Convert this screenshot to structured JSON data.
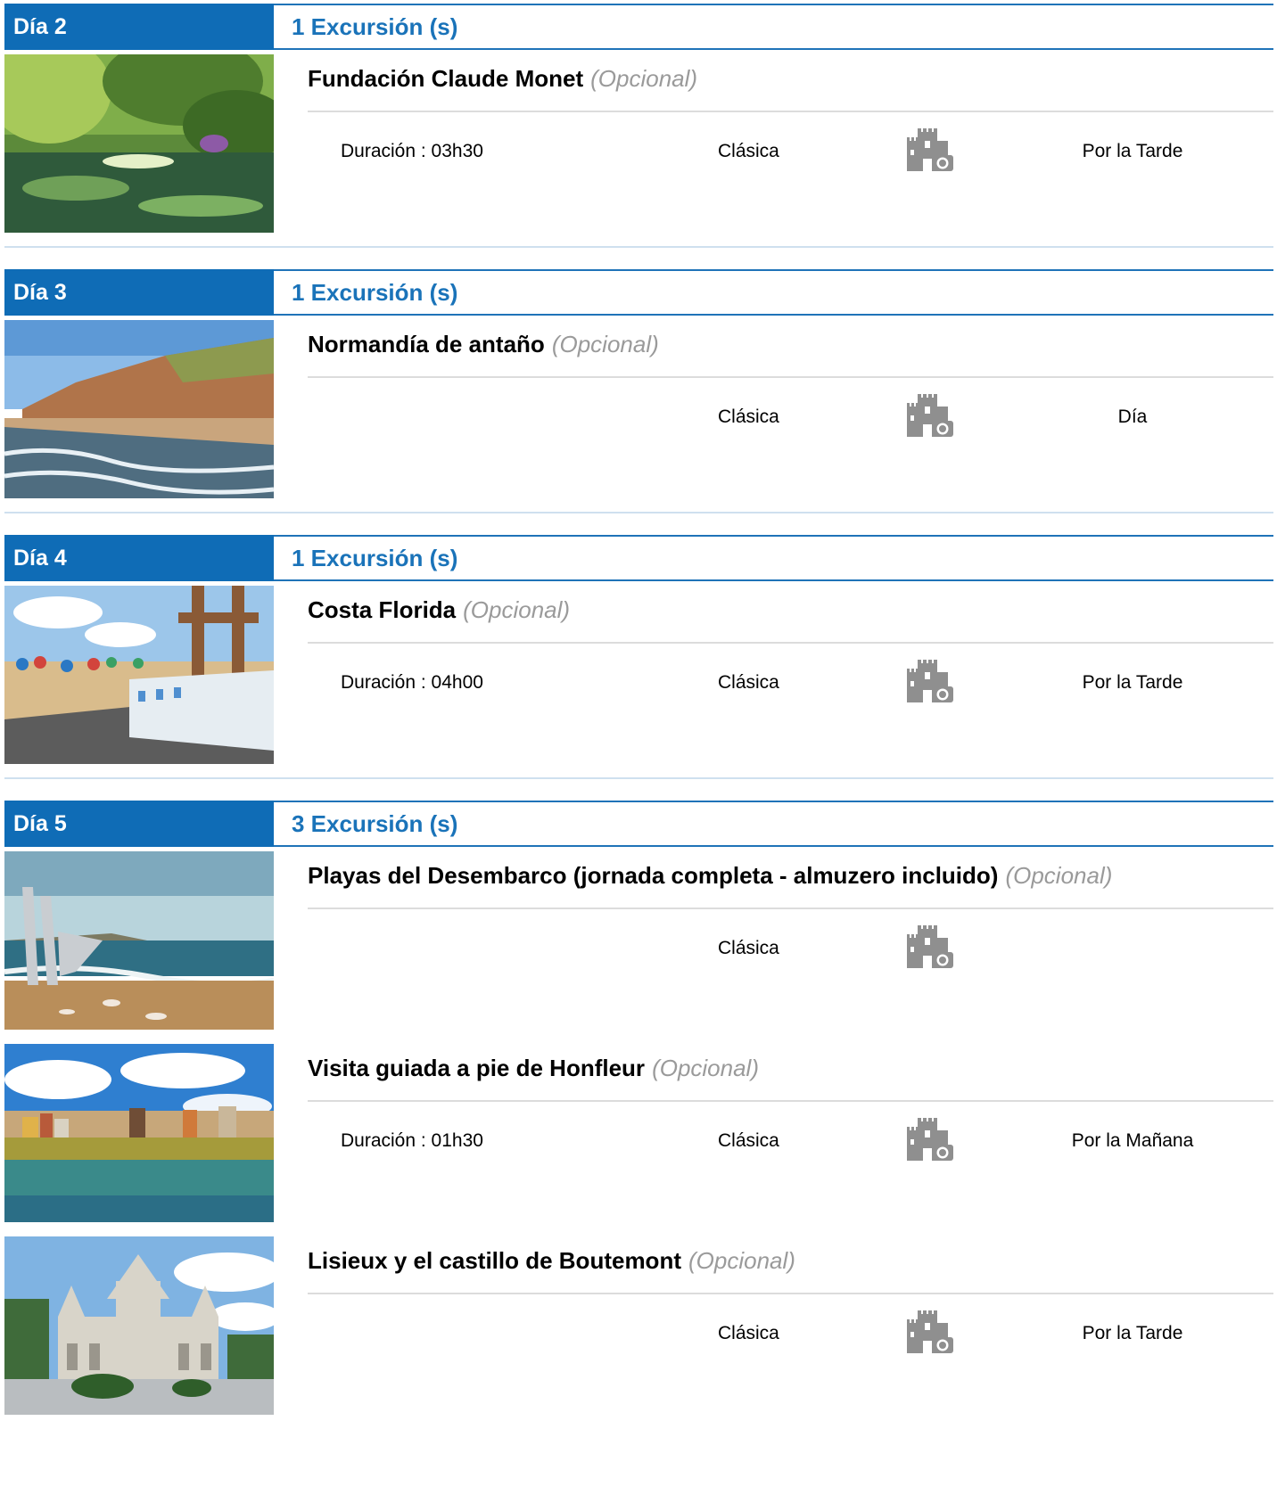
{
  "days": [
    {
      "label": "Día 2",
      "count": "1 Excursión (s)",
      "excursions": [
        {
          "name": "Fundación Claude Monet",
          "optional": "(Opcional)",
          "duration": "Duración : 03h30",
          "type": "Clásica",
          "icon": "castle-camera-icon",
          "time": "Por la Tarde"
        }
      ]
    },
    {
      "label": "Día 3",
      "count": "1 Excursión (s)",
      "excursions": [
        {
          "name": "Normandía de antaño",
          "optional": "(Opcional)",
          "duration": "",
          "type": "Clásica",
          "icon": "castle-camera-icon",
          "time": "Día"
        }
      ]
    },
    {
      "label": "Día 4",
      "count": "1 Excursión (s)",
      "excursions": [
        {
          "name": "Costa Florida",
          "optional": "(Opcional)",
          "duration": "Duración : 04h00",
          "type": "Clásica",
          "icon": "castle-camera-icon",
          "time": "Por la Tarde"
        }
      ]
    },
    {
      "label": "Día 5",
      "count": "3 Excursión (s)",
      "excursions": [
        {
          "name": "Playas del Desembarco (jornada completa - almuzero incluido)",
          "optional": "(Opcional)",
          "duration": "",
          "type": "Clásica",
          "icon": "castle-camera-icon",
          "time": ""
        },
        {
          "name": "Visita guiada a pie de Honfleur",
          "optional": "(Opcional)",
          "duration": "Duración : 01h30",
          "type": "Clásica",
          "icon": "castle-camera-icon",
          "time": "Por la Mañana"
        },
        {
          "name": "Lisieux y el castillo de Boutemont",
          "optional": "(Opcional)",
          "duration": "",
          "type": "Clásica",
          "icon": "castle-camera-icon",
          "time": "Por la Tarde"
        }
      ]
    }
  ],
  "colors": {
    "header_blue": "#0f6cb6",
    "count_blue": "#1a73b9",
    "optional_grey": "#9a9a9a"
  }
}
